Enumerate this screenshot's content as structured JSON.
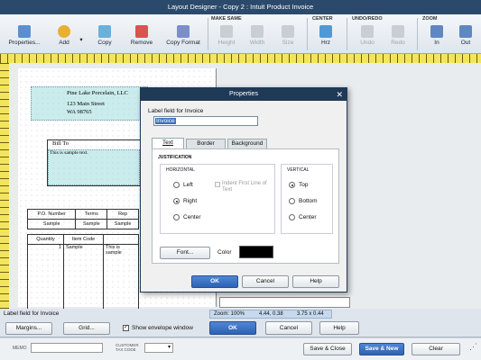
{
  "window": {
    "title": "Layout Designer - Copy 2 : Intuit Product Invoice"
  },
  "ribbon": {
    "groups": {
      "make_same": "MAKE SAME",
      "center": "CENTER",
      "undo_redo": "UNDO/REDO",
      "zoom": "ZOOM"
    },
    "buttons": {
      "properties": "Properties...",
      "add": "Add",
      "copy": "Copy",
      "remove": "Remove",
      "copy_format": "Copy Format",
      "height": "Height",
      "width": "Width",
      "size": "Size",
      "horz": "Hrz",
      "undo": "Undo",
      "redo": "Redo",
      "zoom_in": "In",
      "zoom_out": "Out"
    }
  },
  "invoice": {
    "company_name": "Pine Lake Porcelain, LLC",
    "address_line1": "123 Main Street",
    "address_line2": "WA 98765",
    "bill_to_label": "Bill To",
    "sample_text": "This is sample text.",
    "po_header": [
      "P.O. Number",
      "Terms",
      "Rep"
    ],
    "po_row": [
      "Sample",
      "Sample",
      "Sample"
    ],
    "items_header": [
      "Quantity",
      "Item Code",
      ""
    ],
    "items_row": [
      "1",
      "Sample",
      "This is sample"
    ]
  },
  "dialog": {
    "title": "Properties",
    "label_field_caption": "Label field for Invoice",
    "label_field_value": "Invoice",
    "tabs": [
      "Text",
      "Border",
      "Background"
    ],
    "justification_label": "JUSTIFICATION",
    "horizontal_label": "HORIZONTAL",
    "vertical_label": "VERTICAL",
    "horizontal_options": [
      "Left",
      "Right",
      "Center"
    ],
    "horizontal_selected": "Right",
    "indent_label": "Indent First Line of Text",
    "vertical_options": [
      "Top",
      "Bottom",
      "Center"
    ],
    "vertical_selected": "Top",
    "font_button": "Font...",
    "color_label": "Color",
    "color_value": "#000000",
    "ok": "OK",
    "cancel": "Cancel",
    "help": "Help"
  },
  "status": {
    "field_label": "Label field for Invoice",
    "zoom": "Zoom: 100%",
    "position": "4.44, 0.38",
    "size": "3.75 x 0.44"
  },
  "toolbar": {
    "margins": "Margins...",
    "grid": "Grid...",
    "show_envelope": "Show envelope window",
    "show_envelope_checked": true,
    "ok": "OK",
    "cancel": "Cancel",
    "help": "Help"
  },
  "bottom": {
    "memo_label": "MEMO",
    "customer_tax_code_label": "CUSTOMER TAX CODE",
    "save_close": "Save & Close",
    "save_new": "Save & New",
    "clear": "Clear"
  },
  "colors": {
    "title_bar": "#2b4a6b",
    "primary_button": "#2e62b3",
    "field_highlight": "#a0dcdc",
    "ruler": "#f3e45f"
  }
}
